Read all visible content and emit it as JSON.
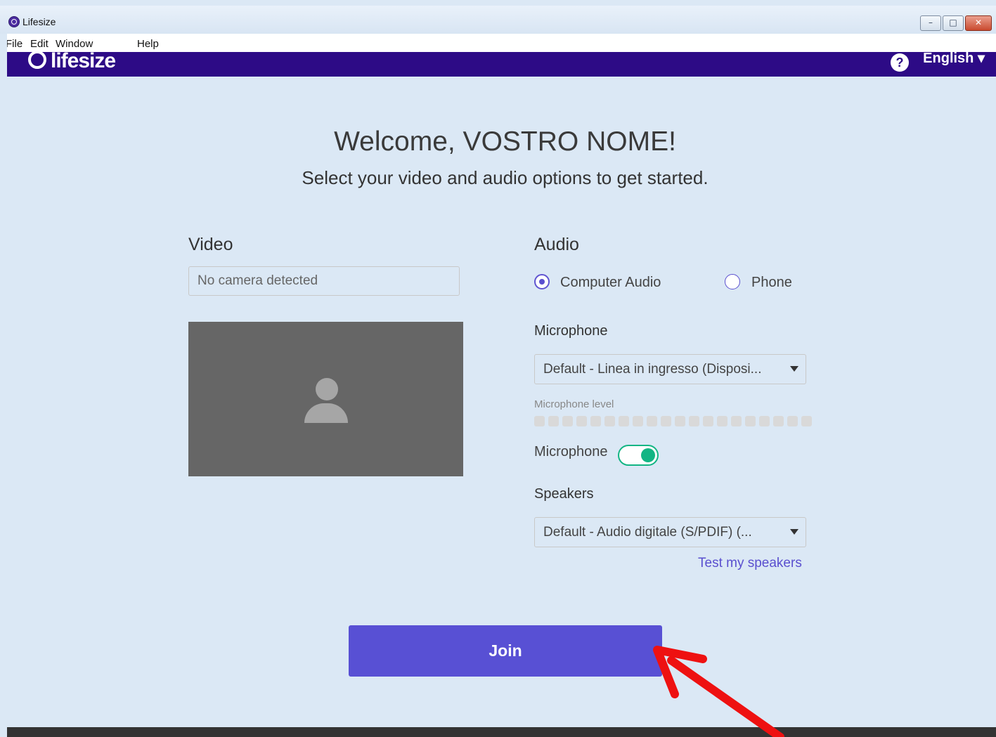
{
  "window": {
    "title": "Lifesize",
    "minimize_glyph": "–",
    "maximize_glyph": "□",
    "close_glyph": "✕"
  },
  "menu": [
    "File",
    "Edit",
    "Window",
    "Help"
  ],
  "header": {
    "logo": "lifesize",
    "help_glyph": "?",
    "language": "English ▾"
  },
  "welcome": {
    "title": "Welcome, VOSTRO NOME!",
    "subtitle": "Select your video and audio options to get started."
  },
  "video": {
    "section_title": "Video",
    "camera_select": "No camera detected"
  },
  "audio": {
    "section_title": "Audio",
    "options": [
      {
        "label": "Computer Audio",
        "selected": true
      },
      {
        "label": "Phone",
        "selected": false
      }
    ],
    "microphone_title": "Microphone",
    "microphone_select": "Default - Linea in ingresso (Disposi...",
    "microphone_level_label": "Microphone level",
    "microphone_level": 0,
    "microphone_toggle_label": "Microphone",
    "microphone_on": true,
    "speakers_title": "Speakers",
    "speakers_select": "Default - Audio digitale (S/PDIF) (...",
    "test_speakers": "Test my speakers"
  },
  "join_label": "Join",
  "colors": {
    "header_bg": "#2d0b86",
    "accent": "#5850d4",
    "toggle": "#13b584",
    "annotation_arrow": "#ee1111"
  }
}
